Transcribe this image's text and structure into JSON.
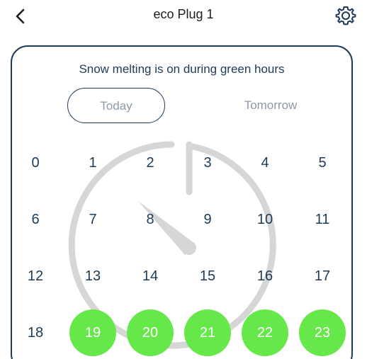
{
  "header": {
    "title": "eco Plug 1",
    "back_icon": "chevron-left-icon",
    "settings_icon": "gear-icon"
  },
  "card": {
    "message": "Snow melting is on during green hours",
    "tabs": [
      {
        "label": "Today",
        "selected": true
      },
      {
        "label": "Tomorrow",
        "selected": false
      }
    ]
  },
  "hours": [
    {
      "label": "0",
      "on": false
    },
    {
      "label": "1",
      "on": false
    },
    {
      "label": "2",
      "on": false
    },
    {
      "label": "3",
      "on": false
    },
    {
      "label": "4",
      "on": false
    },
    {
      "label": "5",
      "on": false
    },
    {
      "label": "6",
      "on": false
    },
    {
      "label": "7",
      "on": false
    },
    {
      "label": "8",
      "on": false
    },
    {
      "label": "9",
      "on": false
    },
    {
      "label": "10",
      "on": false
    },
    {
      "label": "11",
      "on": false
    },
    {
      "label": "12",
      "on": false
    },
    {
      "label": "13",
      "on": false
    },
    {
      "label": "14",
      "on": false
    },
    {
      "label": "15",
      "on": false
    },
    {
      "label": "16",
      "on": false
    },
    {
      "label": "17",
      "on": false
    },
    {
      "label": "18",
      "on": false
    },
    {
      "label": "19",
      "on": true
    },
    {
      "label": "20",
      "on": true
    },
    {
      "label": "21",
      "on": true
    },
    {
      "label": "22",
      "on": true
    },
    {
      "label": "23",
      "on": true
    }
  ],
  "colors": {
    "on": "#66e84a",
    "border": "#1f3a57",
    "muted": "#8c9aa8"
  }
}
